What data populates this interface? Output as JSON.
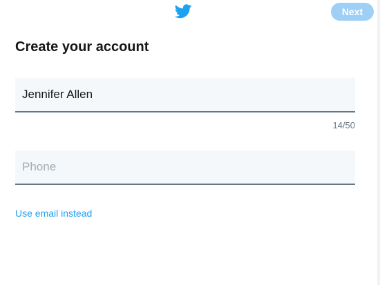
{
  "header": {
    "logo_icon": "twitter-bird-icon",
    "next_label": "Next"
  },
  "form": {
    "title": "Create your account",
    "name_value": "Jennifer Allen",
    "name_counter": "14/50",
    "phone_placeholder": "Phone",
    "phone_value": "",
    "switch_link": "Use email instead"
  },
  "colors": {
    "brand_blue": "#1da1f2",
    "next_button_disabled": "#9ed0f6",
    "input_background": "#f5f8fa",
    "input_border": "#657786"
  }
}
